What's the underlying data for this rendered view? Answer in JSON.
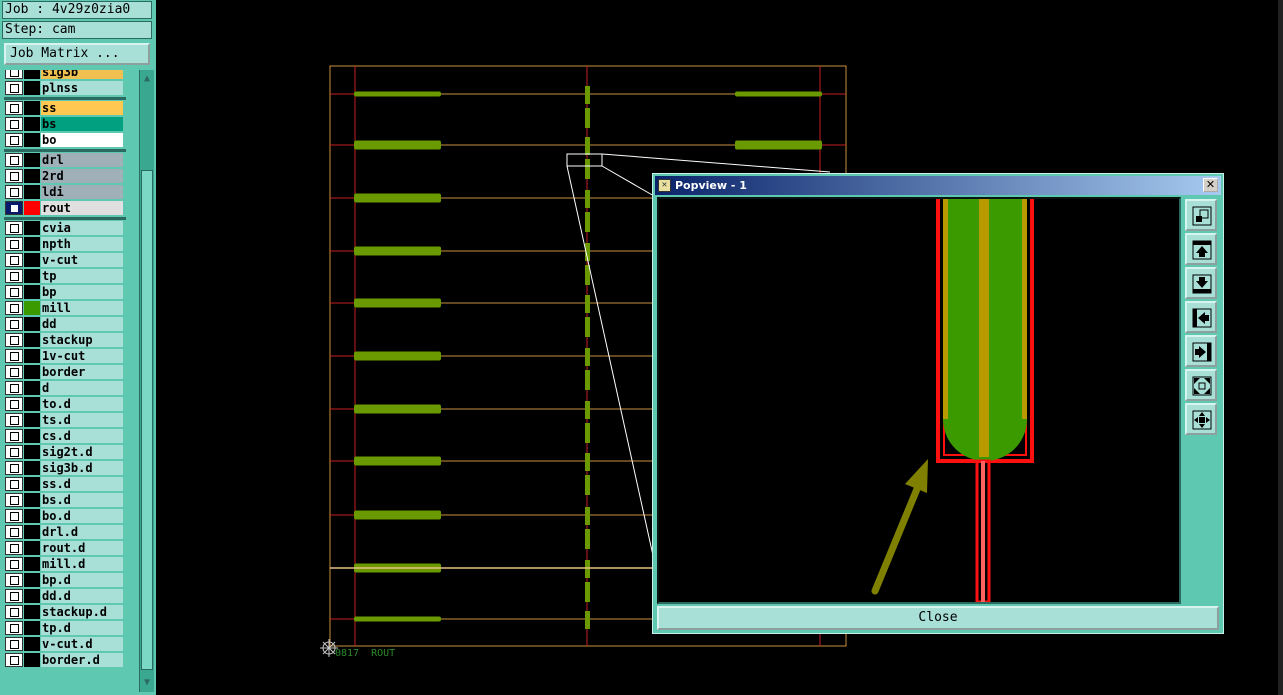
{
  "app": {
    "job_label": "Job : 4v29z0zia0",
    "step_label": "Step: cam",
    "job_matrix_button": "Job Matrix ..."
  },
  "layers": [
    {
      "name": "sig3b",
      "fill": "#f0c050",
      "swatch": "#000000",
      "checked": false
    },
    {
      "name": "plnss",
      "fill": "#a8e0d8",
      "swatch": "#000000",
      "checked": false
    },
    {
      "name": "ss",
      "fill": "#ffc850",
      "swatch": "#000000",
      "checked": false
    },
    {
      "name": "bs",
      "fill": "#00a080",
      "swatch": "#000000",
      "checked": false
    },
    {
      "name": "bo",
      "fill": "#ffffff",
      "swatch": "#000000",
      "checked": false
    },
    {
      "name": "drl",
      "fill": "#a0b0b8",
      "swatch": "#000000",
      "checked": false
    },
    {
      "name": "2rd",
      "fill": "#a0b0b8",
      "swatch": "#000000",
      "checked": false
    },
    {
      "name": "ldi",
      "fill": "#a0b0b8",
      "swatch": "#000000",
      "checked": false
    },
    {
      "name": "rout",
      "fill": "#e0e0e0",
      "swatch": "#ff0000",
      "checked": true
    },
    {
      "name": "cvia",
      "fill": "#a8e0d8",
      "swatch": "#000000",
      "checked": false
    },
    {
      "name": "npth",
      "fill": "#a8e0d8",
      "swatch": "#000000",
      "checked": false
    },
    {
      "name": "v-cut",
      "fill": "#a8e0d8",
      "swatch": "#000000",
      "checked": false
    },
    {
      "name": "tp",
      "fill": "#a8e0d8",
      "swatch": "#000000",
      "checked": false
    },
    {
      "name": "bp",
      "fill": "#a8e0d8",
      "swatch": "#000000",
      "checked": false
    },
    {
      "name": "mill",
      "fill": "#a8e0d8",
      "swatch": "#3a9a00",
      "checked": false
    },
    {
      "name": "dd",
      "fill": "#a8e0d8",
      "swatch": "#000000",
      "checked": false
    },
    {
      "name": "stackup",
      "fill": "#a8e0d8",
      "swatch": "#000000",
      "checked": false
    },
    {
      "name": "1v-cut",
      "fill": "#a8e0d8",
      "swatch": "#000000",
      "checked": false
    },
    {
      "name": "border",
      "fill": "#a8e0d8",
      "swatch": "#000000",
      "checked": false
    },
    {
      "name": "d",
      "fill": "#a8e0d8",
      "swatch": "#000000",
      "checked": false
    },
    {
      "name": "to.d",
      "fill": "#a8e0d8",
      "swatch": "#000000",
      "checked": false
    },
    {
      "name": "ts.d",
      "fill": "#a8e0d8",
      "swatch": "#000000",
      "checked": false
    },
    {
      "name": "cs.d",
      "fill": "#a8e0d8",
      "swatch": "#000000",
      "checked": false
    },
    {
      "name": "sig2t.d",
      "fill": "#a8e0d8",
      "swatch": "#000000",
      "checked": false
    },
    {
      "name": "sig3b.d",
      "fill": "#a8e0d8",
      "swatch": "#000000",
      "checked": false
    },
    {
      "name": "ss.d",
      "fill": "#a8e0d8",
      "swatch": "#000000",
      "checked": false
    },
    {
      "name": "bs.d",
      "fill": "#a8e0d8",
      "swatch": "#000000",
      "checked": false
    },
    {
      "name": "bo.d",
      "fill": "#a8e0d8",
      "swatch": "#000000",
      "checked": false
    },
    {
      "name": "drl.d",
      "fill": "#a8e0d8",
      "swatch": "#000000",
      "checked": false
    },
    {
      "name": "rout.d",
      "fill": "#a8e0d8",
      "swatch": "#000000",
      "checked": false
    },
    {
      "name": "mill.d",
      "fill": "#a8e0d8",
      "swatch": "#000000",
      "checked": false
    },
    {
      "name": "bp.d",
      "fill": "#a8e0d8",
      "swatch": "#000000",
      "checked": false
    },
    {
      "name": "dd.d",
      "fill": "#a8e0d8",
      "swatch": "#000000",
      "checked": false
    },
    {
      "name": "stackup.d",
      "fill": "#a8e0d8",
      "swatch": "#000000",
      "checked": false
    },
    {
      "name": "tp.d",
      "fill": "#a8e0d8",
      "swatch": "#000000",
      "checked": false
    },
    {
      "name": "v-cut.d",
      "fill": "#a8e0d8",
      "swatch": "#000000",
      "checked": false
    },
    {
      "name": "border.d",
      "fill": "#a8e0d8",
      "swatch": "#000000",
      "checked": false
    }
  ],
  "canvas": {
    "readout": "0817  ROUT",
    "colors": {
      "profile": "#c89040",
      "rout": "#ff0000",
      "mill": "#6a9a00",
      "background": "#000000"
    }
  },
  "popview": {
    "title": "Popview - 1",
    "close_label": "Close",
    "toolbar_icons": [
      "zoom-fit-icon",
      "pan-up-icon",
      "pan-down-icon",
      "pan-left-icon",
      "pan-right-icon",
      "zoom-in-icon",
      "zoom-out-icon"
    ]
  }
}
